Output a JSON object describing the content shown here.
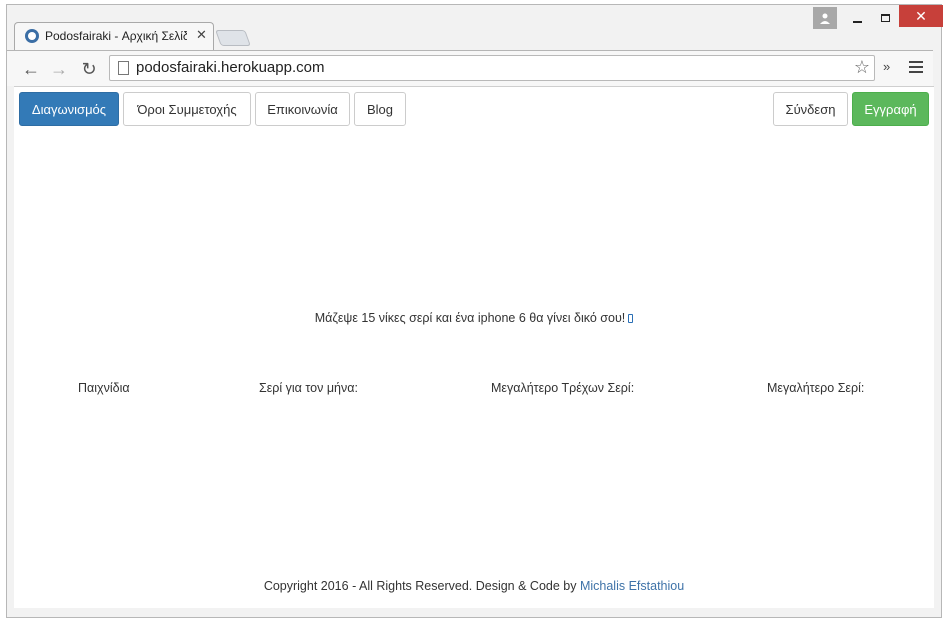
{
  "browser": {
    "tab_title": "Podosfairaki - Αρχική Σελίδα",
    "url": "podosfairaki.herokuapp.com"
  },
  "nav": {
    "left": [
      "Διαγωνισμός",
      "Όροι Συμμετοχής",
      "Επικοινωνία",
      "Blog"
    ],
    "login": "Σύνδεση",
    "register": "Εγγραφή"
  },
  "promo": {
    "text": "Μάζεψε 15 νίκες σερί και ένα iphone 6 θα γίνει δικό σου!",
    "icon": "mobile-phone-icon"
  },
  "stats": {
    "games": "Παιχνίδια",
    "month_streak": "Σερί για τον μήνα:",
    "current_streak": "Μεγαλήτερο Τρέχων Σερί:",
    "max_streak": "Μεγαλήτερο Σερί:"
  },
  "footer": {
    "text": "Copyright 2016 - All Rights Reserved. Design & Code by",
    "author": "Michalis Efstathiou"
  },
  "colors": {
    "primary": "#337ab7",
    "success": "#5cb85c",
    "link": "#3f73a8",
    "close": "#c7403a"
  }
}
